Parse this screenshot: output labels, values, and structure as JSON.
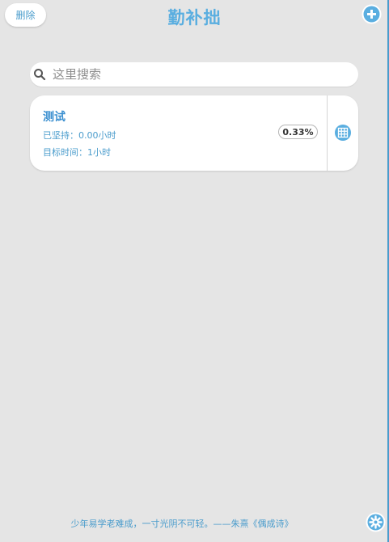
{
  "header": {
    "delete_label": "删除",
    "title": "勤补拙",
    "add_icon": "plus-circle-icon"
  },
  "search": {
    "placeholder": "这里搜索",
    "value": "",
    "icon": "search-icon"
  },
  "items": [
    {
      "title": "测试",
      "persisted": "已坚持：0.00小时",
      "target": "目标时间：1小时",
      "percent": "0.33%",
      "progress_fraction": 0.0033,
      "action_icon": "grid-icon"
    }
  ],
  "footer": {
    "quote": "少年易学老难成，一寸光阴不可轻。——朱熹《偶成诗》",
    "settings_icon": "gear-icon"
  },
  "colors": {
    "background": "#e5e5e5",
    "accent": "#5aaee0",
    "accent_dark": "#3a8fd0",
    "text_blue": "#4a9ccc",
    "card": "#ffffff"
  }
}
